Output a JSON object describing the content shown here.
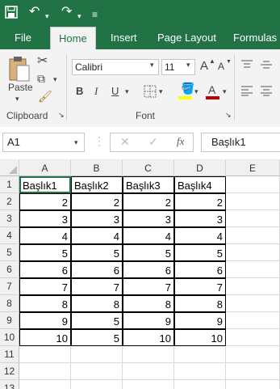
{
  "quick_access": {
    "save_icon": "save-icon",
    "undo_icon": "undo-icon",
    "redo_icon": "redo-icon",
    "customize_icon": "customize-icon"
  },
  "tabs": [
    "File",
    "Home",
    "Insert",
    "Page Layout",
    "Formulas"
  ],
  "ribbon": {
    "paste_label": "Paste",
    "clipboard_label": "Clipboard",
    "font_label": "Font",
    "font_name": "Calibri",
    "font_size": "11",
    "bold": "B",
    "italic": "I",
    "underline": "U",
    "grow_font": "A",
    "shrink_font": "A",
    "font_color_letter": "A"
  },
  "formula_bar": {
    "name_box": "A1",
    "fx": "fx",
    "content": "Başlık1"
  },
  "columns": [
    "A",
    "B",
    "C",
    "D",
    "E"
  ],
  "rows": [
    "1",
    "2",
    "3",
    "4",
    "5",
    "6",
    "7",
    "8",
    "9",
    "10",
    "11",
    "12",
    "13"
  ],
  "headers": [
    "Başlık1",
    "Başlık2",
    "Başlık3",
    "Başlık4"
  ],
  "table": [
    [
      "2",
      "2",
      "2",
      "2"
    ],
    [
      "3",
      "3",
      "3",
      "3"
    ],
    [
      "4",
      "4",
      "4",
      "4"
    ],
    [
      "5",
      "5",
      "5",
      "5"
    ],
    [
      "6",
      "6",
      "6",
      "6"
    ],
    [
      "7",
      "7",
      "7",
      "7"
    ],
    [
      "8",
      "8",
      "8",
      "8"
    ],
    [
      "9",
      "5",
      "9",
      "9"
    ],
    [
      "10",
      "5",
      "10",
      "10"
    ]
  ],
  "colors": {
    "excel_green": "#217346",
    "font_color_bar": "#c00000",
    "highlight_bar": "#ffff00"
  }
}
